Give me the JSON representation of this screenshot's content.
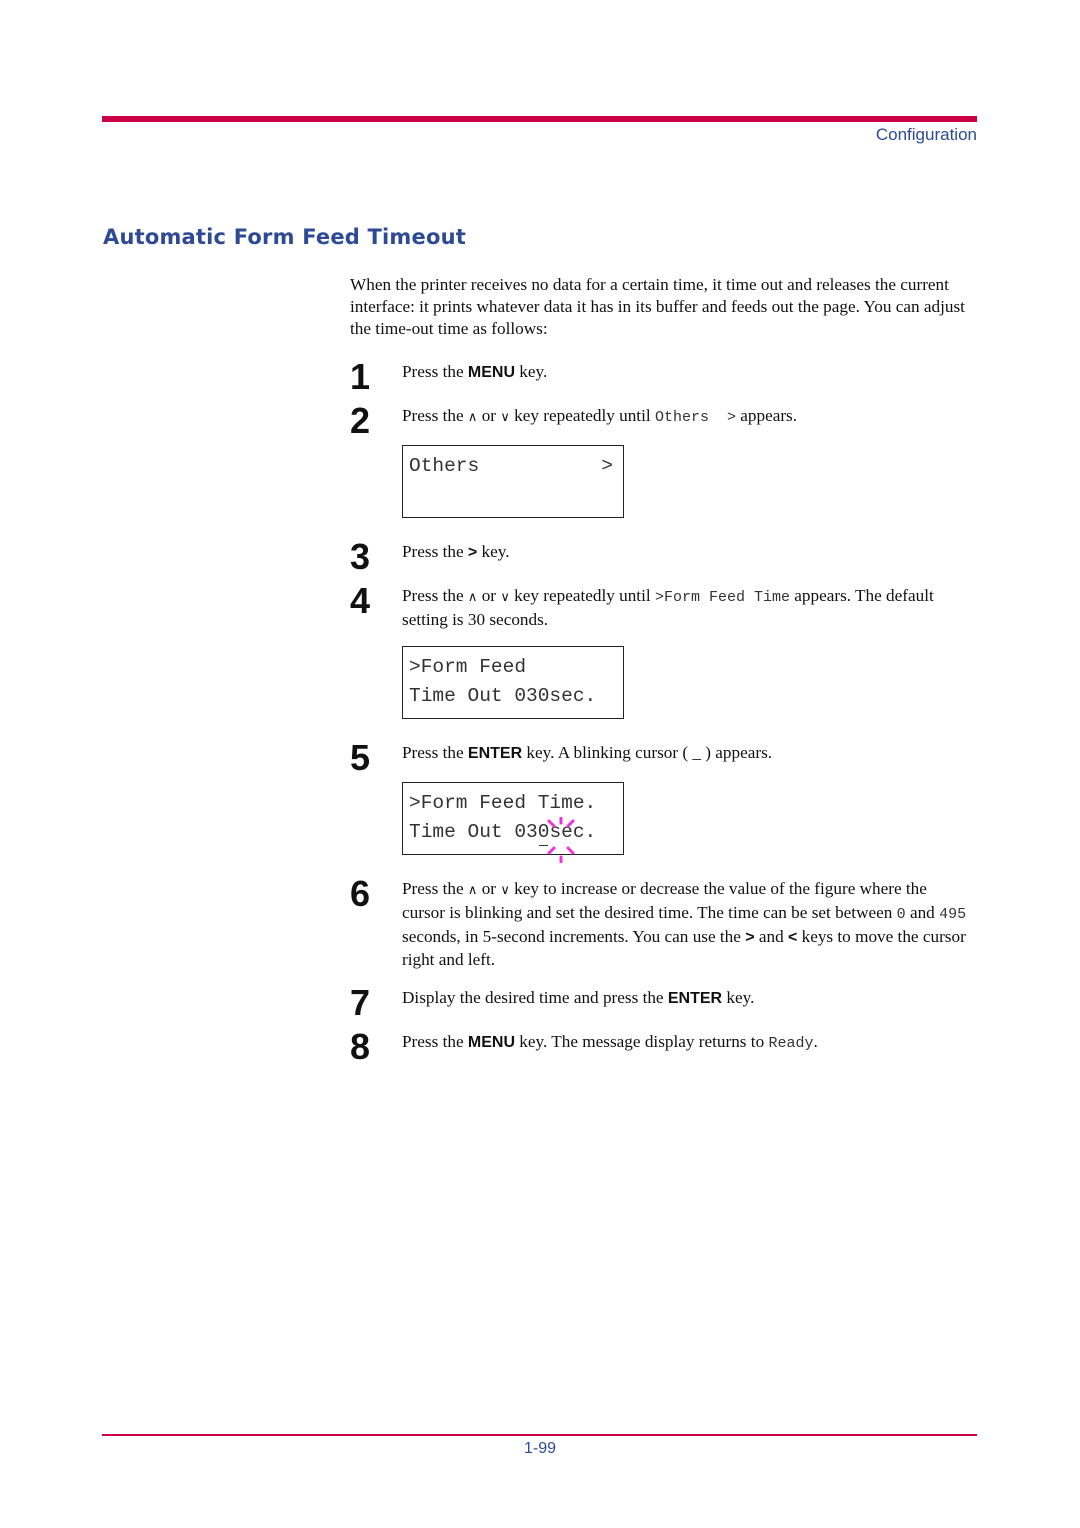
{
  "header": {
    "section": "Configuration",
    "accent_color": "#cc0044",
    "heading_color": "#2e4a94"
  },
  "title": "Automatic Form Feed Timeout",
  "intro": "When the printer receives no data for a certain time, it time out and releases the current interface: it prints whatever data it has in its buffer and feeds out the page. You can adjust the time-out time as follows:",
  "steps": [
    {
      "num": "1",
      "t1": "Press the ",
      "k1": "MENU",
      "t2": " key."
    },
    {
      "num": "2",
      "t1": "Press the ",
      "up": "up-key-icon",
      "t2": " or ",
      "down": "down-key-icon",
      "t3": " key repeatedly until ",
      "m1": "Others  >",
      "t4": " appears."
    },
    {
      "num": "3",
      "t1": "Press the ",
      "k1": ">",
      "t2": " key."
    },
    {
      "num": "4",
      "t1": "Press the ",
      "t2": " or ",
      "t3": " key repeatedly until ",
      "m1": ">Form Feed Time",
      "t4": " appears. The default setting is 30 seconds."
    },
    {
      "num": "5",
      "t1": "Press the ",
      "k1": "ENTER",
      "t2": " key. A blinking cursor ( _ ) appears."
    },
    {
      "num": "6",
      "t1": "Press the ",
      "t2": " or ",
      "t3": " key to increase or decrease the value of the figure where the cursor is blinking and set the desired time. The time can be set between ",
      "m1": "0",
      "t4": " and ",
      "m2": "495",
      "t5": " seconds, in 5-second increments. You can use the ",
      "k1": ">",
      "t6": " and ",
      "k2": "<",
      "t7": " keys to move the cursor right and left."
    },
    {
      "num": "7",
      "t1": "Display the desired time and press the ",
      "k1": "ENTER",
      "t2": " key."
    },
    {
      "num": "8",
      "t1": "Press the ",
      "k1": "MENU",
      "t2": " key. The message display returns to ",
      "m1": "Ready",
      "t3": "."
    }
  ],
  "icons": {
    "up": "∧",
    "down": "∨"
  },
  "displays": {
    "others": {
      "line1": "Others",
      "line1_right": ">"
    },
    "form_feed": {
      "line1": ">Form Feed",
      "line2": "Time Out 030sec."
    },
    "form_feed_edit": {
      "line1": ">Form Feed Time.",
      "line2_a": "Time Out 03",
      "line2_cursor": "0",
      "line2_b": "sec.",
      "blink_color": "#ee33dd"
    }
  },
  "footer": {
    "page": "1-99"
  }
}
